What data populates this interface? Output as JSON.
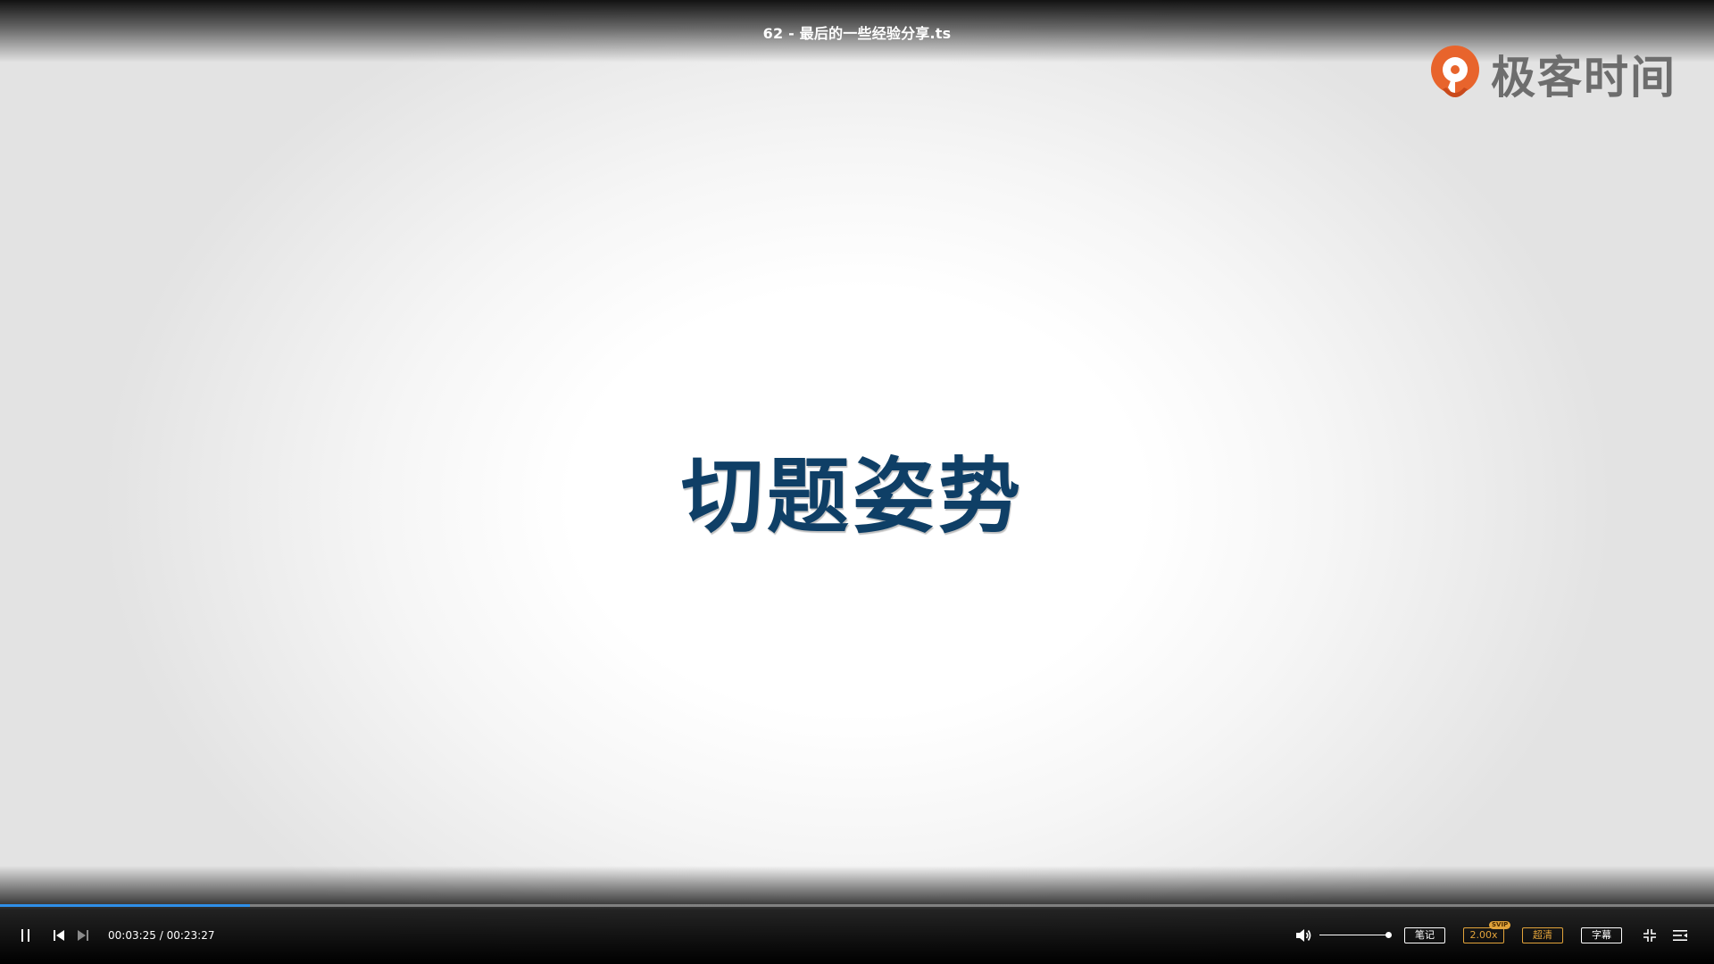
{
  "window": {
    "title": "62 - 最后的一些经验分享.ts"
  },
  "watermark": {
    "brand": "极客时间",
    "brand_color": "#e8642c",
    "icon": "geektime-logo-icon"
  },
  "slide": {
    "heading": "切题姿势",
    "heading_color": "#0f3f66"
  },
  "playback": {
    "current_time": "00:03:25",
    "total_time": "00:23:27",
    "progress_fraction": 0.1457,
    "progress_color": "#2f8fe8",
    "state": "playing"
  },
  "volume": {
    "level_fraction": 1.0
  },
  "controls": {
    "notes_label": "笔记",
    "speed_label": "2.00x",
    "speed_badge": "SVIP",
    "quality_label": "超清",
    "subtitle_label": "字幕",
    "accent_color": "#e2a33a",
    "icons": {
      "pause": "pause-icon",
      "previous": "skip-previous-icon",
      "next": "skip-next-icon",
      "volume": "volume-icon",
      "exit_fullscreen": "exit-fullscreen-icon",
      "playlist": "playlist-icon"
    }
  }
}
